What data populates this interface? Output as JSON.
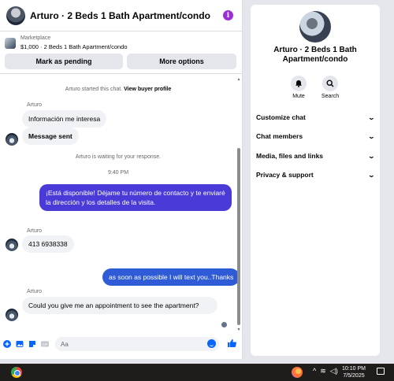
{
  "header": {
    "title": "Arturo · 2 Beds 1 Bath Apartment/condo",
    "info_icon": "i"
  },
  "marketplace": {
    "label": "Marketplace",
    "listing": "$1,000 · 2 Beds 1 Bath Apartment/condo",
    "pending_button": "Mark as pending",
    "more_button": "More options"
  },
  "messages": {
    "started": "Arturo started this chat.",
    "view_profile": "View buyer profile",
    "sender1": "Arturo",
    "msg1": "Información me interesa",
    "msg2": "Message sent",
    "waiting": "Arturo is waiting for your response.",
    "time": "9:40 PM",
    "out1": "¡Está disponible! Déjame tu número de contacto y te enviaré la dirección y los detalles de la visita.",
    "sender2": "Arturo",
    "msg3": "413 6938338",
    "out2": "as soon as possible I will text you..Thanks",
    "sender3": "Arturo",
    "msg4": "Could you give me an appointment to see the apartment?"
  },
  "composer": {
    "placeholder": "Aa"
  },
  "profile": {
    "name": "Arturo · 2 Beds 1 Bath Apartment/condo",
    "mute": "Mute",
    "search": "Search",
    "sections": [
      "Customize chat",
      "Chat members",
      "Media, files and links",
      "Privacy & support"
    ]
  },
  "taskbar": {
    "time": "10:10 PM",
    "date": "7/5/2025"
  },
  "icons": {
    "bell": "bell-icon",
    "search": "search-icon",
    "plus": "plus-icon",
    "photo": "photo-icon",
    "sticker": "sticker-icon",
    "gif": "gif-icon",
    "emoji": "emoji-icon",
    "like": "thumbs-up-icon"
  },
  "colors": {
    "accent": "#0866ff",
    "outgoing_bubble": "#4a3ad8",
    "info": "#9b2fd4"
  }
}
